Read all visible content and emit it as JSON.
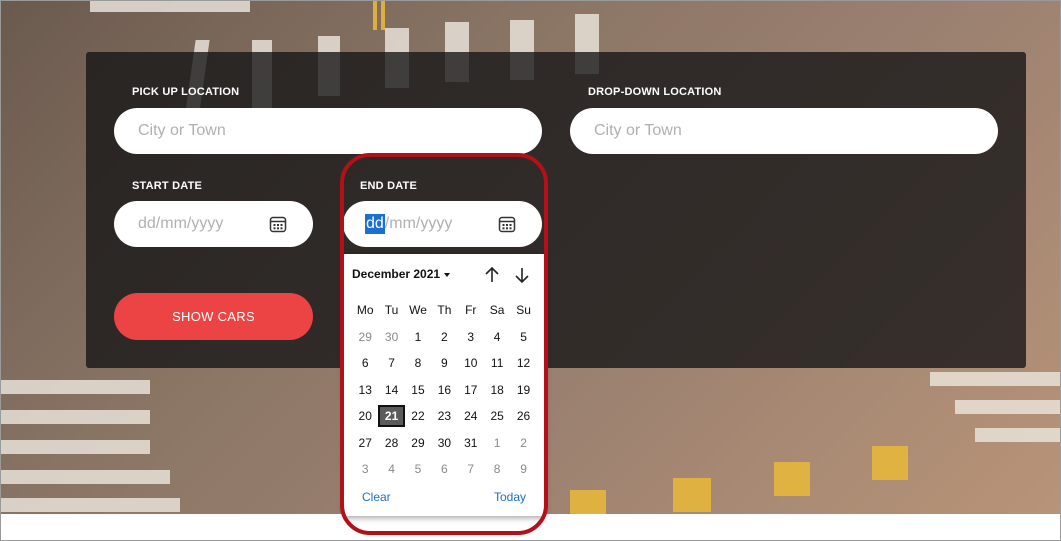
{
  "form": {
    "pickup_label": "PICK UP LOCATION",
    "pickup_placeholder": "City or Town",
    "dropoff_label": "DROP-DOWN LOCATION",
    "dropoff_placeholder": "City or Town",
    "start_label": "START DATE",
    "start_placeholder": "dd/mm/yyyy",
    "end_label": "END DATE",
    "end_segment_selected": "dd",
    "end_rest": "/mm/yyyy",
    "show_cars": "SHOW CARS"
  },
  "datepicker": {
    "month": "December 2021",
    "weekdays": [
      "Mo",
      "Tu",
      "We",
      "Th",
      "Fr",
      "Sa",
      "Su"
    ],
    "weeks": [
      [
        {
          "d": "29",
          "m": true
        },
        {
          "d": "30",
          "m": true
        },
        {
          "d": "1"
        },
        {
          "d": "2"
        },
        {
          "d": "3"
        },
        {
          "d": "4"
        },
        {
          "d": "5"
        }
      ],
      [
        {
          "d": "6"
        },
        {
          "d": "7"
        },
        {
          "d": "8"
        },
        {
          "d": "9"
        },
        {
          "d": "10"
        },
        {
          "d": "11"
        },
        {
          "d": "12"
        }
      ],
      [
        {
          "d": "13"
        },
        {
          "d": "14"
        },
        {
          "d": "15"
        },
        {
          "d": "16"
        },
        {
          "d": "17"
        },
        {
          "d": "18"
        },
        {
          "d": "19"
        }
      ],
      [
        {
          "d": "20"
        },
        {
          "d": "21",
          "s": true
        },
        {
          "d": "22"
        },
        {
          "d": "23"
        },
        {
          "d": "24"
        },
        {
          "d": "25"
        },
        {
          "d": "26"
        }
      ],
      [
        {
          "d": "27"
        },
        {
          "d": "28"
        },
        {
          "d": "29"
        },
        {
          "d": "30"
        },
        {
          "d": "31"
        },
        {
          "d": "1",
          "m": true
        },
        {
          "d": "2",
          "m": true
        }
      ],
      [
        {
          "d": "3",
          "m": true
        },
        {
          "d": "4",
          "m": true
        },
        {
          "d": "5",
          "m": true
        },
        {
          "d": "6",
          "m": true
        },
        {
          "d": "7",
          "m": true
        },
        {
          "d": "8",
          "m": true
        },
        {
          "d": "9",
          "m": true
        }
      ]
    ],
    "clear": "Clear",
    "today": "Today"
  },
  "colors": {
    "accent_button": "#ec4444",
    "highlight_ring": "#b3101a",
    "link_blue": "#1a6fd0",
    "panel_overlay": "#141416"
  }
}
